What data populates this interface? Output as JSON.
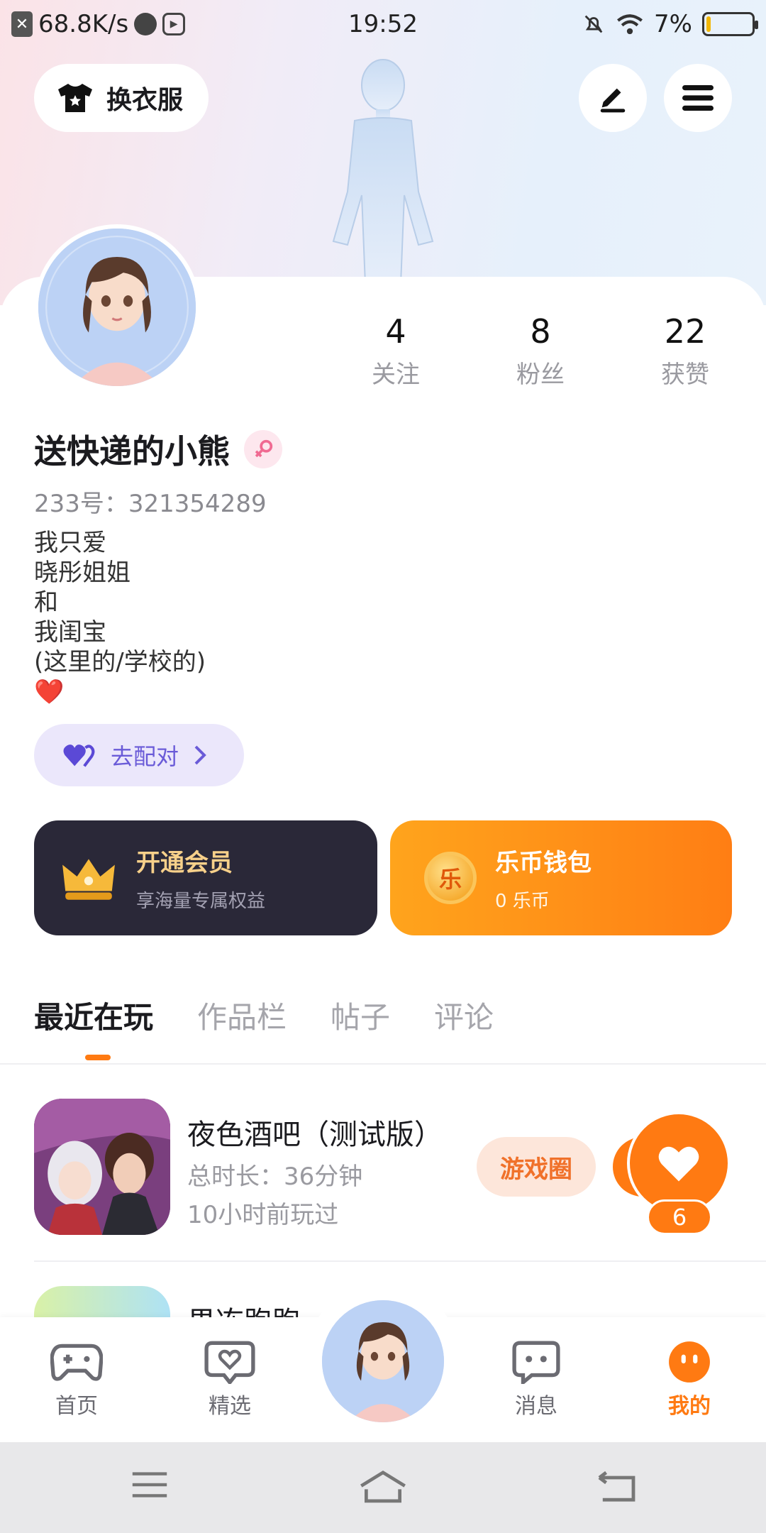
{
  "status_bar": {
    "net_speed": "68.8K/s",
    "time": "19:52",
    "battery_percent": "7%",
    "icons": [
      "close-box-icon",
      "app-dot-icon",
      "media-icon",
      "mute-bell-icon",
      "wifi-icon",
      "battery-icon"
    ]
  },
  "header": {
    "outfit_label": "换衣服",
    "edit_icon": "pen-icon",
    "menu_icon": "hamburger-icon"
  },
  "profile": {
    "username": "送快递的小熊",
    "gender": "female",
    "id_line": "233号：321354289",
    "bio_lines": [
      "我只爱",
      "晓彤姐姐",
      "和",
      "我闺宝",
      "(这里的/学校的)",
      "❤️"
    ],
    "match_label": "去配对",
    "stats": [
      {
        "value": "4",
        "label": "关注"
      },
      {
        "value": "8",
        "label": "粉丝"
      },
      {
        "value": "22",
        "label": "获赞"
      }
    ]
  },
  "vip": {
    "title": "开通会员",
    "subtitle": "享海量专属权益"
  },
  "wallet": {
    "title": "乐币钱包",
    "subtitle": "0 乐币",
    "coin_glyph": "乐"
  },
  "tabs": [
    {
      "label": "最近在玩",
      "active": true
    },
    {
      "label": "作品栏",
      "active": false
    },
    {
      "label": "帖子",
      "active": false
    },
    {
      "label": "评论",
      "active": false
    }
  ],
  "games": [
    {
      "name": "夜色酒吧（测试版）",
      "duration": "总时长：36分钟",
      "last_played": "10小时前玩过",
      "action": "游戏圈"
    },
    {
      "name": "果冻跑跑"
    }
  ],
  "like": {
    "count": "6"
  },
  "bottom_nav": [
    {
      "label": "首页",
      "icon": "gamepad-icon",
      "active": false
    },
    {
      "label": "精选",
      "icon": "heart-chat-icon",
      "active": false
    },
    {
      "label": "消息",
      "icon": "message-icon",
      "active": false
    },
    {
      "label": "我的",
      "icon": "profile-face-icon",
      "active": true
    }
  ],
  "colors": {
    "accent": "#ff7a12",
    "vip_bg": "#2a2838",
    "match_bg": "#ebe7fb"
  }
}
